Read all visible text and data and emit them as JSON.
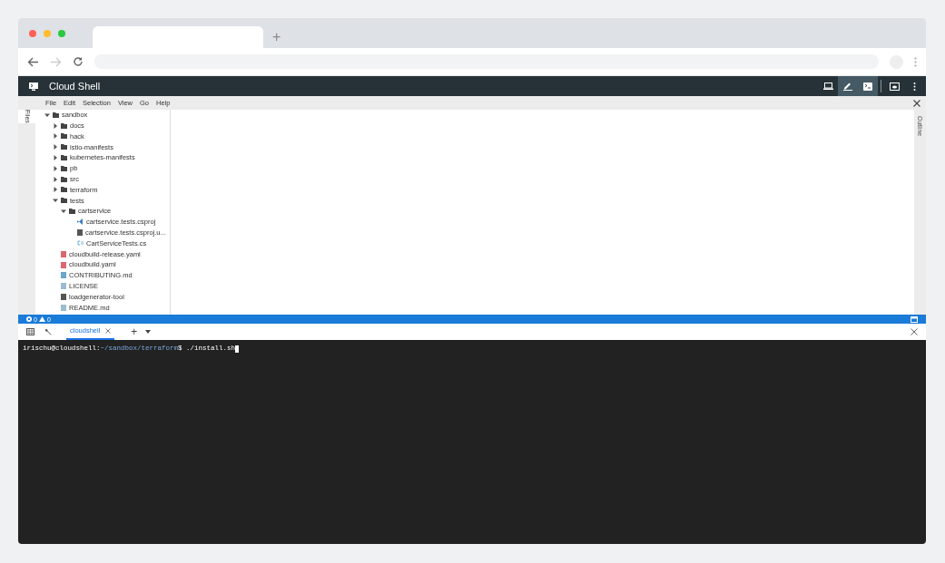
{
  "browser": {
    "new_tab": "+"
  },
  "header": {
    "title": "Cloud Shell",
    "buttons": [
      {
        "kind": "laptop",
        "selected": false
      },
      {
        "kind": "pencil",
        "selected": true
      },
      {
        "kind": "terminal",
        "selected": true
      },
      {
        "kind": "preview",
        "selected": false
      },
      {
        "kind": "more",
        "selected": false
      }
    ]
  },
  "menu": [
    "File",
    "Edit",
    "Selection",
    "View",
    "Go",
    "Help"
  ],
  "left_panel": {
    "tab": "Files"
  },
  "right_panel": {
    "tab": "Outline"
  },
  "tree": [
    {
      "label": "sandbox",
      "kind": "folder",
      "expanded": true,
      "children": [
        {
          "label": "docs",
          "kind": "folder",
          "expanded": false
        },
        {
          "label": "hack",
          "kind": "folder",
          "expanded": false
        },
        {
          "label": "istio-manifests",
          "kind": "folder",
          "expanded": false
        },
        {
          "label": "kubernetes-manifests",
          "kind": "folder",
          "expanded": false
        },
        {
          "label": "pb",
          "kind": "folder",
          "expanded": false
        },
        {
          "label": "src",
          "kind": "folder",
          "expanded": false
        },
        {
          "label": "terraform",
          "kind": "folder",
          "expanded": false
        },
        {
          "label": "tests",
          "kind": "folder",
          "expanded": true,
          "children": [
            {
              "label": "cartservice",
              "kind": "folder",
              "expanded": true,
              "children": [
                {
                  "label": "cartservice.tests.csproj",
                  "kind": "project"
                },
                {
                  "label": "cartservice.tests.csproj.u...",
                  "kind": "file"
                },
                {
                  "label": "CartServiceTests.cs",
                  "kind": "csharp"
                }
              ]
            }
          ]
        },
        {
          "label": "cloudbuild-release.yaml",
          "kind": "yaml"
        },
        {
          "label": "cloudbuild.yaml",
          "kind": "yaml"
        },
        {
          "label": "CONTRIBUTING.md",
          "kind": "markdown"
        },
        {
          "label": "LICENSE",
          "kind": "text"
        },
        {
          "label": "loadgenerator-tool",
          "kind": "file"
        },
        {
          "label": "README.md",
          "kind": "text"
        }
      ]
    }
  ],
  "status_bar": {
    "errors": "0",
    "warnings": "0"
  },
  "terminal": {
    "tabs": [
      {
        "label": "cloudshell",
        "selected": true
      }
    ],
    "add": "+",
    "prompt_user": "irischu@cloudshell:",
    "prompt_path": "~/sandbox/terraform",
    "prompt_end": "$",
    "command": "./install.sh"
  }
}
